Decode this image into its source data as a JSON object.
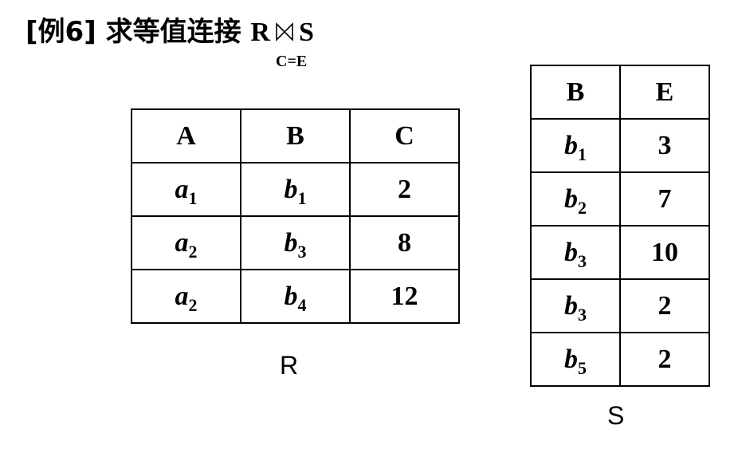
{
  "title": {
    "prefix": "[例6] 求等值连接",
    "left_relation": "R",
    "right_relation": "S",
    "join_condition": "C=E",
    "join-icon": "bowtie-join-icon"
  },
  "table_r": {
    "caption": "R",
    "headers": [
      "A",
      "B",
      "C"
    ],
    "rows": [
      [
        {
          "v": "a",
          "s": "1"
        },
        {
          "v": "b",
          "s": "1"
        },
        {
          "v": "2"
        }
      ],
      [
        {
          "v": "a",
          "s": "2"
        },
        {
          "v": "b",
          "s": "3"
        },
        {
          "v": "8"
        }
      ],
      [
        {
          "v": "a",
          "s": "2"
        },
        {
          "v": "b",
          "s": "4"
        },
        {
          "v": "12"
        }
      ]
    ]
  },
  "table_s": {
    "caption": "S",
    "headers": [
      "B",
      "E"
    ],
    "rows": [
      [
        {
          "v": "b",
          "s": "1"
        },
        {
          "v": "3"
        }
      ],
      [
        {
          "v": "b",
          "s": "2"
        },
        {
          "v": "7"
        }
      ],
      [
        {
          "v": "b",
          "s": "3"
        },
        {
          "v": "10"
        }
      ],
      [
        {
          "v": "b",
          "s": "3"
        },
        {
          "v": "2"
        }
      ],
      [
        {
          "v": "b",
          "s": "5"
        },
        {
          "v": "2"
        }
      ]
    ]
  }
}
